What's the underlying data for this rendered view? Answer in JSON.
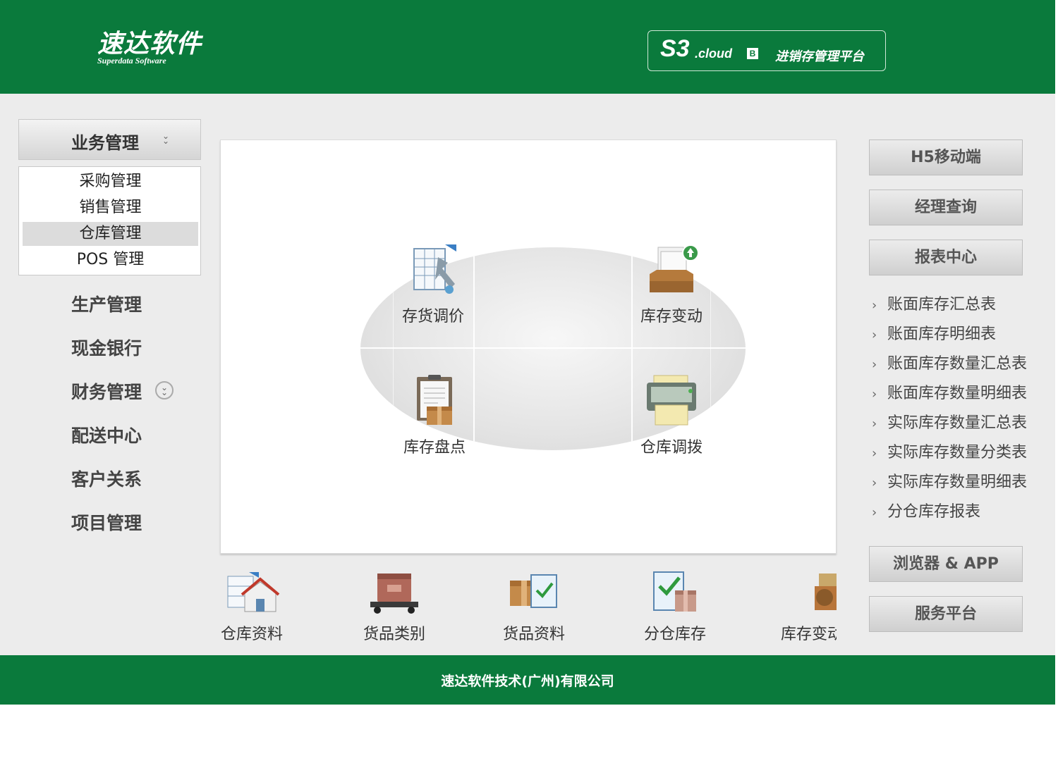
{
  "header": {
    "logo_main": "速达软件",
    "logo_sub": "Superdata Software",
    "product_s3": "S3",
    "product_cloud": ".cloud",
    "product_badge": "B",
    "product_title": "进销存管理平台"
  },
  "nav": {
    "header_label": "业务管理",
    "sub_items": [
      "采购管理",
      "销售管理",
      "仓库管理",
      "POS 管理"
    ],
    "active_sub_item": "仓库管理",
    "items": [
      "生产管理",
      "现金银行",
      "财务管理",
      "配送中心",
      "客户关系",
      "项目管理"
    ]
  },
  "main": {
    "quadrants": [
      {
        "label": "存货调价",
        "icon": "spreadsheet-arrow-icon"
      },
      {
        "label": "库存变动",
        "icon": "inbox-upload-icon"
      },
      {
        "label": "库存盘点",
        "icon": "clipboard-box-icon"
      },
      {
        "label": "仓库调拨",
        "icon": "printer-icon"
      }
    ],
    "bottom_items": [
      {
        "label": "仓库资料",
        "icon": "warehouse-house-icon"
      },
      {
        "label": "货品类别",
        "icon": "package-cart-icon"
      },
      {
        "label": "货品资料",
        "icon": "box-checklist-icon"
      },
      {
        "label": "分仓库存",
        "icon": "checklist-box-icon"
      },
      {
        "label": "库存变动",
        "icon": "inventory-change-icon"
      }
    ]
  },
  "right": {
    "buttons_top": [
      "H5移动端",
      "经理查询",
      "报表中心"
    ],
    "report_links": [
      "账面库存汇总表",
      "账面库存明细表",
      "账面库存数量汇总表",
      "账面库存数量明细表",
      "实际库存数量汇总表",
      "实际库存数量分类表",
      "实际库存数量明细表",
      "分仓库存报表"
    ],
    "buttons_bottom": [
      "浏览器 & APP",
      "服务平台"
    ]
  },
  "footer": {
    "company": "速达软件技术(广州)有限公司"
  },
  "colors": {
    "brand_green": "#0a7a3c",
    "panel_bg": "#ececec"
  }
}
